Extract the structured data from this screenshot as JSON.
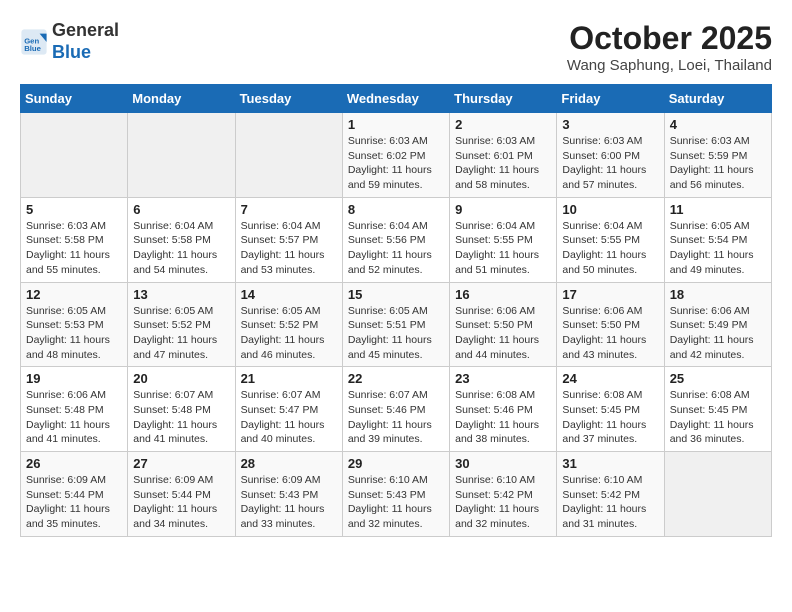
{
  "header": {
    "logo_line1": "General",
    "logo_line2": "Blue",
    "month": "October 2025",
    "location": "Wang Saphung, Loei, Thailand"
  },
  "days_of_week": [
    "Sunday",
    "Monday",
    "Tuesday",
    "Wednesday",
    "Thursday",
    "Friday",
    "Saturday"
  ],
  "weeks": [
    [
      {
        "day": "",
        "info": ""
      },
      {
        "day": "",
        "info": ""
      },
      {
        "day": "",
        "info": ""
      },
      {
        "day": "1",
        "info": "Sunrise: 6:03 AM\nSunset: 6:02 PM\nDaylight: 11 hours\nand 59 minutes."
      },
      {
        "day": "2",
        "info": "Sunrise: 6:03 AM\nSunset: 6:01 PM\nDaylight: 11 hours\nand 58 minutes."
      },
      {
        "day": "3",
        "info": "Sunrise: 6:03 AM\nSunset: 6:00 PM\nDaylight: 11 hours\nand 57 minutes."
      },
      {
        "day": "4",
        "info": "Sunrise: 6:03 AM\nSunset: 5:59 PM\nDaylight: 11 hours\nand 56 minutes."
      }
    ],
    [
      {
        "day": "5",
        "info": "Sunrise: 6:03 AM\nSunset: 5:58 PM\nDaylight: 11 hours\nand 55 minutes."
      },
      {
        "day": "6",
        "info": "Sunrise: 6:04 AM\nSunset: 5:58 PM\nDaylight: 11 hours\nand 54 minutes."
      },
      {
        "day": "7",
        "info": "Sunrise: 6:04 AM\nSunset: 5:57 PM\nDaylight: 11 hours\nand 53 minutes."
      },
      {
        "day": "8",
        "info": "Sunrise: 6:04 AM\nSunset: 5:56 PM\nDaylight: 11 hours\nand 52 minutes."
      },
      {
        "day": "9",
        "info": "Sunrise: 6:04 AM\nSunset: 5:55 PM\nDaylight: 11 hours\nand 51 minutes."
      },
      {
        "day": "10",
        "info": "Sunrise: 6:04 AM\nSunset: 5:55 PM\nDaylight: 11 hours\nand 50 minutes."
      },
      {
        "day": "11",
        "info": "Sunrise: 6:05 AM\nSunset: 5:54 PM\nDaylight: 11 hours\nand 49 minutes."
      }
    ],
    [
      {
        "day": "12",
        "info": "Sunrise: 6:05 AM\nSunset: 5:53 PM\nDaylight: 11 hours\nand 48 minutes."
      },
      {
        "day": "13",
        "info": "Sunrise: 6:05 AM\nSunset: 5:52 PM\nDaylight: 11 hours\nand 47 minutes."
      },
      {
        "day": "14",
        "info": "Sunrise: 6:05 AM\nSunset: 5:52 PM\nDaylight: 11 hours\nand 46 minutes."
      },
      {
        "day": "15",
        "info": "Sunrise: 6:05 AM\nSunset: 5:51 PM\nDaylight: 11 hours\nand 45 minutes."
      },
      {
        "day": "16",
        "info": "Sunrise: 6:06 AM\nSunset: 5:50 PM\nDaylight: 11 hours\nand 44 minutes."
      },
      {
        "day": "17",
        "info": "Sunrise: 6:06 AM\nSunset: 5:50 PM\nDaylight: 11 hours\nand 43 minutes."
      },
      {
        "day": "18",
        "info": "Sunrise: 6:06 AM\nSunset: 5:49 PM\nDaylight: 11 hours\nand 42 minutes."
      }
    ],
    [
      {
        "day": "19",
        "info": "Sunrise: 6:06 AM\nSunset: 5:48 PM\nDaylight: 11 hours\nand 41 minutes."
      },
      {
        "day": "20",
        "info": "Sunrise: 6:07 AM\nSunset: 5:48 PM\nDaylight: 11 hours\nand 41 minutes."
      },
      {
        "day": "21",
        "info": "Sunrise: 6:07 AM\nSunset: 5:47 PM\nDaylight: 11 hours\nand 40 minutes."
      },
      {
        "day": "22",
        "info": "Sunrise: 6:07 AM\nSunset: 5:46 PM\nDaylight: 11 hours\nand 39 minutes."
      },
      {
        "day": "23",
        "info": "Sunrise: 6:08 AM\nSunset: 5:46 PM\nDaylight: 11 hours\nand 38 minutes."
      },
      {
        "day": "24",
        "info": "Sunrise: 6:08 AM\nSunset: 5:45 PM\nDaylight: 11 hours\nand 37 minutes."
      },
      {
        "day": "25",
        "info": "Sunrise: 6:08 AM\nSunset: 5:45 PM\nDaylight: 11 hours\nand 36 minutes."
      }
    ],
    [
      {
        "day": "26",
        "info": "Sunrise: 6:09 AM\nSunset: 5:44 PM\nDaylight: 11 hours\nand 35 minutes."
      },
      {
        "day": "27",
        "info": "Sunrise: 6:09 AM\nSunset: 5:44 PM\nDaylight: 11 hours\nand 34 minutes."
      },
      {
        "day": "28",
        "info": "Sunrise: 6:09 AM\nSunset: 5:43 PM\nDaylight: 11 hours\nand 33 minutes."
      },
      {
        "day": "29",
        "info": "Sunrise: 6:10 AM\nSunset: 5:43 PM\nDaylight: 11 hours\nand 32 minutes."
      },
      {
        "day": "30",
        "info": "Sunrise: 6:10 AM\nSunset: 5:42 PM\nDaylight: 11 hours\nand 32 minutes."
      },
      {
        "day": "31",
        "info": "Sunrise: 6:10 AM\nSunset: 5:42 PM\nDaylight: 11 hours\nand 31 minutes."
      },
      {
        "day": "",
        "info": ""
      }
    ]
  ]
}
